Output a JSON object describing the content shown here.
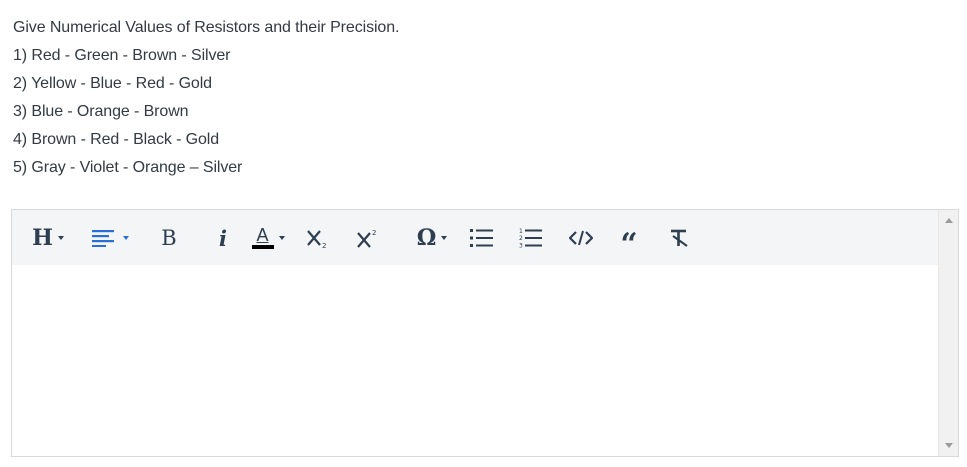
{
  "question": {
    "prompt": "Give Numerical Values of Resistors and their Precision.",
    "items": [
      "1) Red - Green - Brown - Silver",
      "2) Yellow - Blue - Red - Gold",
      "3) Blue - Orange - Brown",
      "4) Brown - Red - Black - Gold",
      "5) Gray - Violet - Orange – Silver"
    ]
  },
  "editor": {
    "toolbar": {
      "heading_label": "H",
      "bold_label": "B",
      "italic_label": "i",
      "font_color_label": "A",
      "special_chars_label": "Ω",
      "quote_label": "“"
    },
    "content_value": "",
    "colors": {
      "toolbar_bg": "#f4f5f6",
      "icon": "#2c3e50",
      "align_icon": "#2a6fd6",
      "font_color_bar": "#000000"
    },
    "icons": [
      "heading-icon",
      "align-left-icon",
      "bold-icon",
      "italic-icon",
      "font-color-icon",
      "subscript-icon",
      "superscript-icon",
      "omega-icon",
      "bulleted-list-icon",
      "numbered-list-icon",
      "code-icon",
      "quote-icon",
      "remove-format-icon"
    ]
  }
}
